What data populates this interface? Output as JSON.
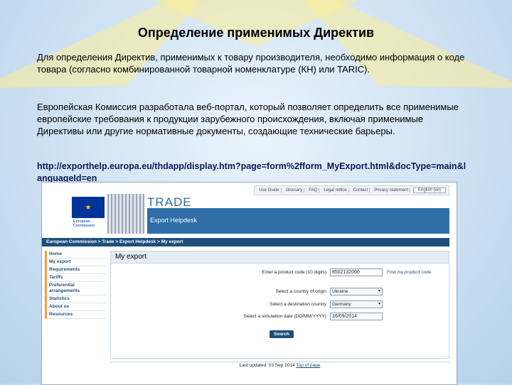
{
  "slide": {
    "title": "Определение применимых Директив",
    "paragraph1": "Для определения Директив, применимых к товару производителя, необходимо информация о коде товара (согласно комбинированной товарной номенклатуре (КН) или TARIC).",
    "paragraph2": "Европейская Комиссия разработала веб-портал, который позволяет определить все применимые европейские требования к продукции зарубежного происхождения, включая применимые Директивы или другие нормативные документы, создающие технические барьеры.",
    "url": "http://exporthelp.europa.eu/thdapp/display.htm?page=form%2fform_MyExport.html&docType=main&languageId=en"
  },
  "screenshot": {
    "utility_links": [
      "Use Guide",
      "Glossary",
      "FAQ",
      "Legal notice",
      "Contact",
      "Privacy statement"
    ],
    "language": "English (en)",
    "ec_logo_text": "European Commission",
    "trade_label": "TRADE",
    "helpdesk_label": "Export Helpdesk",
    "breadcrumb": "European Commission > Trade > Export Helpdesk > My export",
    "sidebar": [
      "Home",
      "My export",
      "Requirements",
      "Tariffs",
      "Preferential arrangements",
      "Statistics",
      "About us",
      "Resources"
    ],
    "main_title": "My export",
    "form": {
      "product_code_label": "Enter a product code (10 digits)",
      "product_code_value": "8502132000",
      "find_code_link": "Find my product code",
      "origin_label": "Select a country of origin",
      "origin_value": "Ukraine",
      "destination_label": "Select a destination country",
      "destination_value": "Germany",
      "date_label": "Select a simulation date (DD/MM/YYYY)",
      "date_value": "16/09/2014",
      "search_label": "Search"
    },
    "footer_text": "Last updated: 03 Sep 2014",
    "footer_link": "Top of page"
  },
  "colors": {
    "ec_blue": "#003399",
    "header_blue": "#2f6ea7",
    "nav_dark": "#1d4f7d",
    "star_yellow": "#fcec96"
  }
}
